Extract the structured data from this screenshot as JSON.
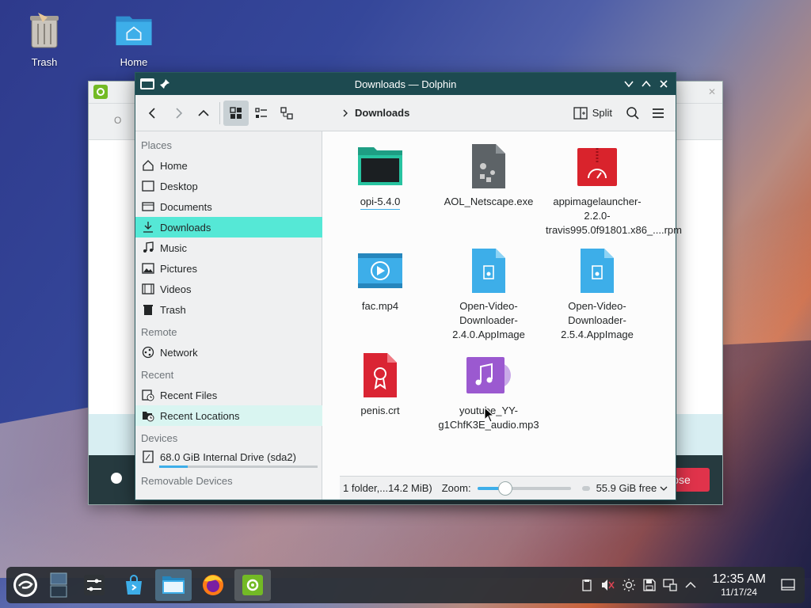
{
  "desktop": {
    "icons": [
      {
        "label": "Trash"
      },
      {
        "label": "Home"
      }
    ]
  },
  "background_window": {
    "close_label": "Close",
    "tab_fragment": "O"
  },
  "window": {
    "title": "Downloads — Dolphin",
    "breadcrumb": "Downloads",
    "split_label": "Split"
  },
  "places": {
    "sections": {
      "places": "Places",
      "remote": "Remote",
      "recent": "Recent",
      "devices": "Devices",
      "removable": "Removable Devices"
    },
    "items": [
      {
        "label": "Home",
        "icon": "home-icon"
      },
      {
        "label": "Desktop",
        "icon": "desktop-icon"
      },
      {
        "label": "Documents",
        "icon": "documents-icon"
      },
      {
        "label": "Downloads",
        "icon": "download-icon"
      },
      {
        "label": "Music",
        "icon": "music-icon"
      },
      {
        "label": "Pictures",
        "icon": "pictures-icon"
      },
      {
        "label": "Videos",
        "icon": "videos-icon"
      },
      {
        "label": "Trash",
        "icon": "trash-icon"
      }
    ],
    "remote": [
      {
        "label": "Network",
        "icon": "network-icon"
      }
    ],
    "recent": [
      {
        "label": "Recent Files",
        "icon": "recent-files-icon"
      },
      {
        "label": "Recent Locations",
        "icon": "recent-locations-icon"
      }
    ],
    "devices": [
      {
        "label": "68.0 GiB Internal Drive (sda2)",
        "icon": "drive-icon",
        "used_fraction": 0.18
      }
    ]
  },
  "files": [
    {
      "name": "opi-5.4.0",
      "kind": "folder"
    },
    {
      "name": "AOL_Netscape.exe",
      "kind": "exe"
    },
    {
      "name": "appimagelauncher-2.2.0-travis995.0f91801.x86_....rpm",
      "kind": "rpm"
    },
    {
      "name": "fac.mp4",
      "kind": "video"
    },
    {
      "name": "Open-Video-Downloader-2.4.0.AppImage",
      "kind": "appimage"
    },
    {
      "name": "Open-Video-Downloader-2.5.4.AppImage",
      "kind": "appimage"
    },
    {
      "name": "penis.crt",
      "kind": "cert"
    },
    {
      "name": "youtube_YY-g1ChfK3E_audio.mp3",
      "kind": "audio"
    }
  ],
  "status": {
    "summary": "1 folder,...14.2 MiB)",
    "zoom_label": "Zoom:",
    "zoom_fraction": 0.3,
    "free_space": "55.9 GiB free"
  },
  "taskbar": {
    "time": "12:35 AM",
    "date": "11/17/24"
  },
  "colors": {
    "accent": "#3daee9",
    "selection": "#55e8d6",
    "titlebar": "#1d4a50"
  }
}
